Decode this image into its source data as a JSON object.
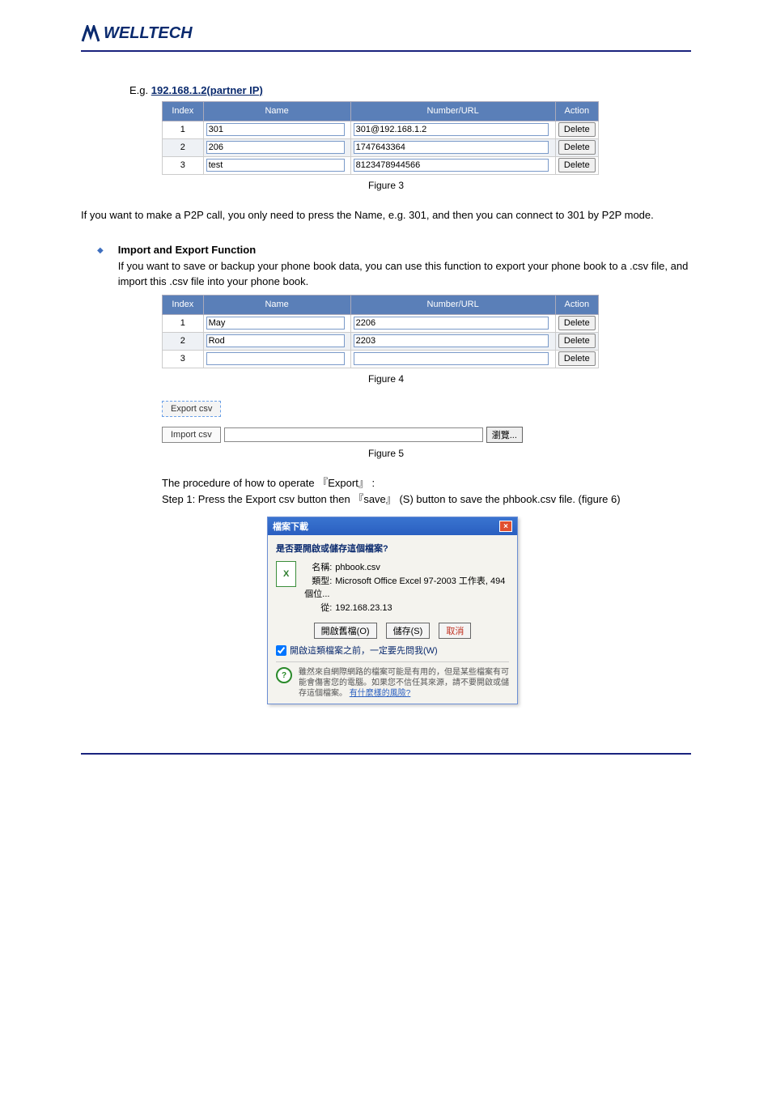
{
  "brand": "WELLTECH",
  "intro": {
    "prefix": "E.g. ",
    "link": "192.168.1.2(partner IP)"
  },
  "fig1_caption": "Figure 3",
  "table1": {
    "headers": {
      "index": "Index",
      "name": "Name",
      "number": "Number/URL",
      "action": "Action"
    },
    "rows": [
      {
        "idx": "1",
        "name": "301",
        "number": "301@192.168.1.2"
      },
      {
        "idx": "2",
        "name": "206",
        "number": "1747643364"
      },
      {
        "idx": "3",
        "name": "test",
        "number": "8123478944566"
      }
    ],
    "delete_label": "Delete"
  },
  "desc1": "If you want to make a P2P call, you only need to press the Name, e.g. 301, and then you can connect to 301 by P2P mode.",
  "bullet_heading": "Import and Export Function",
  "bullet_body": "If you want to save or backup your phone book data, you can use this function to export your phone book to a .csv file, and import this .csv file into your phone book.",
  "table2": {
    "headers": {
      "index": "Index",
      "name": "Name",
      "number": "Number/URL",
      "action": "Action"
    },
    "rows": [
      {
        "idx": "1",
        "name": "May",
        "number": "2206"
      },
      {
        "idx": "2",
        "name": "Rod",
        "number": "2203"
      },
      {
        "idx": "3",
        "name": "",
        "number": ""
      }
    ],
    "delete_label": "Delete"
  },
  "fig2_caption": "Figure 4",
  "export_label": "Export csv",
  "import_label": "Import csv",
  "browse_label": "瀏覽...",
  "fig3_caption": "Figure 5",
  "proc": {
    "p1_a": "The procedure of how to operate ",
    "p1_b": "Export",
    "p1_c": ":",
    "p2_a": "Step 1: Press the Export csv button then",
    "p2_b": "save",
    "p2_c": "(S) button to save the phbook.csv file. (figure 6)"
  },
  "dialog": {
    "title": "檔案下載",
    "question": "是否要開啟或儲存這個檔案?",
    "name_k": "名稱:",
    "name_v": "phbook.csv",
    "type_k": "類型:",
    "type_v": "Microsoft Office Excel 97-2003 工作表, 494 個位...",
    "from_k": "從:",
    "from_v": "192.168.23.13",
    "open": "開啟舊檔(O)",
    "save": "儲存(S)",
    "cancel": "取消",
    "checkbox": "開啟這類檔案之前，一定要先問我(W)",
    "warn": "雖然來自網際網路的檔案可能是有用的，但是某些檔案有可能會傷害您的電腦。如果您不信任其來源，請不要開啟或儲存這個檔案。",
    "warn_link": "有什麼樣的風險?"
  }
}
